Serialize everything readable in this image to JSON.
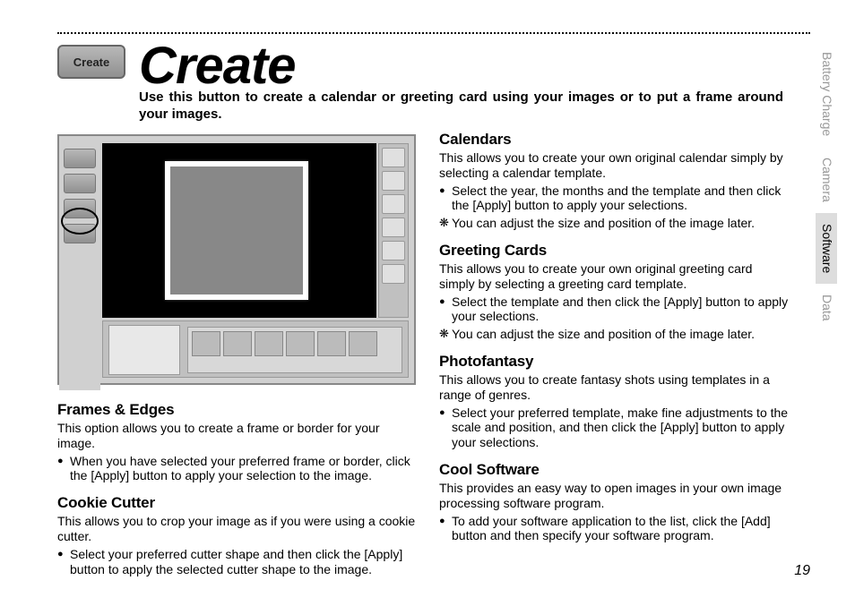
{
  "header": {
    "button_label": "Create",
    "title": "Create",
    "intro": "Use this button to create a calendar or greeting card using your images or to put a frame around your images."
  },
  "left_column": {
    "frames": {
      "heading": "Frames & Edges",
      "body": "This option allows you to create a frame or border for your image.",
      "bullet": "When you have selected your preferred frame or border, click the [Apply] button to apply your selection to the image."
    },
    "cookie": {
      "heading": "Cookie Cutter",
      "body": "This allows you to crop your image as if you were using a cookie cutter.",
      "bullet": "Select your preferred cutter shape and then click the [Apply] button to apply the selected cutter shape to the image."
    }
  },
  "right_column": {
    "calendars": {
      "heading": "Calendars",
      "body": "This allows you to create your own original calendar simply by selecting a calendar template.",
      "bullet": "Select the year, the months and the template and then click the [Apply] button to apply your selections.",
      "aster": "You can adjust the size and position of the image later."
    },
    "greeting": {
      "heading": "Greeting Cards",
      "body": "This allows you to create your own original greeting card simply by selecting a greeting card template.",
      "bullet": "Select the template and then click the [Apply] button to apply your selections.",
      "aster": "You can adjust the size and position of the image later."
    },
    "photo": {
      "heading": "Photofantasy",
      "body": "This allows you to create fantasy shots using templates in a range of genres.",
      "bullet": "Select your preferred template, make fine adjustments to the scale and position, and then click the [Apply] button to apply your selections."
    },
    "cool": {
      "heading": "Cool Software",
      "body": "This provides an easy way to open images in your own image processing software program.",
      "bullet": "To add your software application to the list, click the [Add] button and then specify your software program."
    }
  },
  "tabs": {
    "battery": "Battery Charge",
    "camera": "Camera",
    "software": "Software",
    "data": "Data"
  },
  "page_number": "19"
}
